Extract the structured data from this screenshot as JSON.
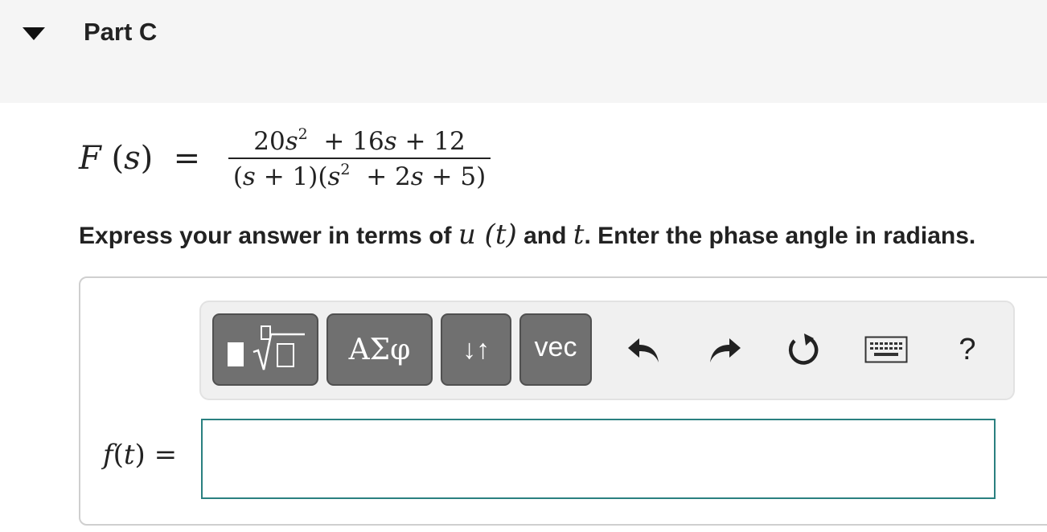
{
  "part": {
    "title": "Part C",
    "collapse_icon": "triangle-down-icon"
  },
  "formula": {
    "lhs_func": "F",
    "lhs_var": "s",
    "equals": "=",
    "num_coef": "20",
    "num_var": "s",
    "num_exp": "2",
    "num_rest_op1": "+ 16",
    "num_rest_var": "s",
    "num_rest_tail": "+ 12",
    "den_open": "(",
    "den_var1": "s",
    "den_mid1": "+ 1)(",
    "den_var2": "s",
    "den_exp": "2",
    "den_mid2": "+ 2",
    "den_var3": "s",
    "den_tail": "+ 5)"
  },
  "instruction": {
    "text1": "Express your answer in terms of ",
    "math1": "u (t)",
    "text2": " and ",
    "math2": "t",
    "text3": ". Enter the phase angle in radians."
  },
  "toolbar": {
    "greek_label": "ΑΣφ",
    "arrows_label": "↓↑",
    "vec_label": "vec",
    "help_label": "?",
    "icons": [
      "templates-icon",
      "undo-icon",
      "redo-icon",
      "reset-icon",
      "keyboard-icon",
      "help-icon"
    ]
  },
  "answer": {
    "label_func": "f",
    "label_var": "t",
    "label_eq": "=",
    "value": ""
  },
  "colors": {
    "button_bg": "#707070",
    "toolbar_bg": "#f0f0f0",
    "input_border": "#2a8080",
    "header_bg": "#f5f5f5"
  }
}
